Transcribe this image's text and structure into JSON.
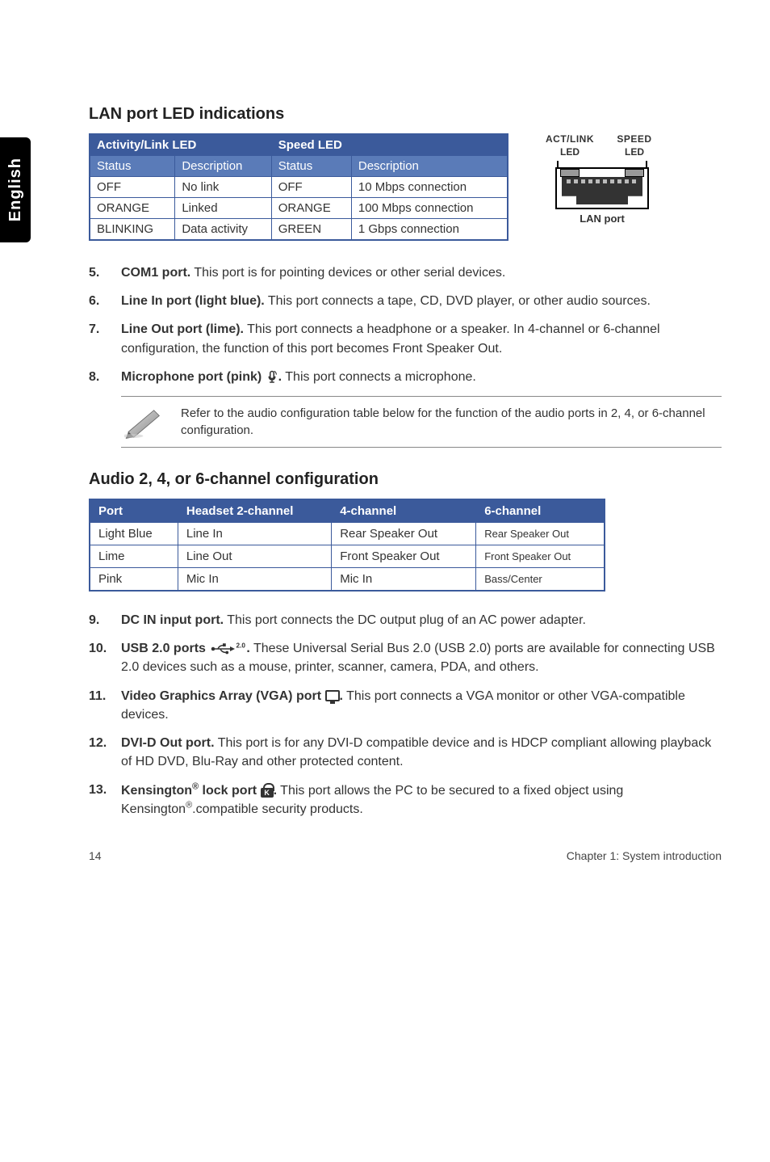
{
  "side_tab": "English",
  "section1_title": "LAN port LED indications",
  "led_table": {
    "group1": "Activity/Link LED",
    "group2": "Speed LED",
    "headers": [
      "Status",
      "Description",
      "Status",
      "Description"
    ],
    "rows": [
      [
        "OFF",
        "No link",
        "OFF",
        "10 Mbps connection"
      ],
      [
        "ORANGE",
        "Linked",
        "ORANGE",
        "100 Mbps connection"
      ],
      [
        "BLINKING",
        "Data activity",
        "GREEN",
        "1 Gbps connection"
      ]
    ]
  },
  "lan_diagram": {
    "top1": "ACT/LINK",
    "top2": "SPEED",
    "sub": "LED",
    "caption": "LAN port"
  },
  "items5to8": [
    {
      "lead": "COM1 port.",
      "text": " This port is for pointing devices or other serial devices."
    },
    {
      "lead": "Line In port (light blue).",
      "text": " This port connects a tape, CD, DVD player, or other audio sources."
    },
    {
      "lead": "Line Out port (lime).",
      "text": " This port connects a headphone or a speaker. In 4-channel or 6-channel configuration, the function of this port becomes Front Speaker Out."
    },
    {
      "lead": "Microphone port (pink) ",
      "icon": "mic",
      "trailing": ".",
      "text": " This port connects a microphone."
    }
  ],
  "note_text": "Refer to the audio configuration table below for the function of the audio ports in 2, 4, or 6-channel configuration.",
  "section2_title": "Audio 2, 4, or 6-channel configuration",
  "audio_table": {
    "headers": [
      "Port",
      "Headset 2-channel",
      "4-channel",
      "6-channel"
    ],
    "rows": [
      [
        "Light Blue",
        "Line In",
        "Rear Speaker Out",
        "Rear Speaker Out"
      ],
      [
        "Lime",
        "Line Out",
        "Front Speaker Out",
        "Front Speaker Out"
      ],
      [
        "Pink",
        "Mic In",
        "Mic In",
        "Bass/Center"
      ]
    ]
  },
  "items9to13": [
    {
      "lead": "DC IN input port.",
      "text": " This port connects the DC output plug of an AC power adapter."
    },
    {
      "lead": "USB 2.0 ports ",
      "icon": "usb",
      "trailing": ".",
      "text": " These Universal Serial Bus 2.0 (USB 2.0) ports are available for connecting USB 2.0 devices such as a mouse, printer, scanner, camera, PDA, and others."
    },
    {
      "lead": "Video Graphics Array (VGA) port ",
      "icon": "vga",
      "trailing": ".",
      "text": " This port connects a VGA monitor or other VGA-compatible devices."
    },
    {
      "lead": "DVI-D Out port.",
      "text": " This port is for any DVI-D compatible device and is HDCP compliant allowing playback of HD DVD, Blu-Ray and other protected content."
    },
    {
      "lead_parts": [
        "Kensington",
        "®",
        " lock port "
      ],
      "icon": "lock",
      "trailing": ".",
      "text_parts": [
        " This port allows the PC to be secured to a fixed object using Kensington",
        "®",
        ".compatible security products."
      ]
    }
  ],
  "footer": {
    "page": "14",
    "chapter": "Chapter 1: System introduction"
  }
}
